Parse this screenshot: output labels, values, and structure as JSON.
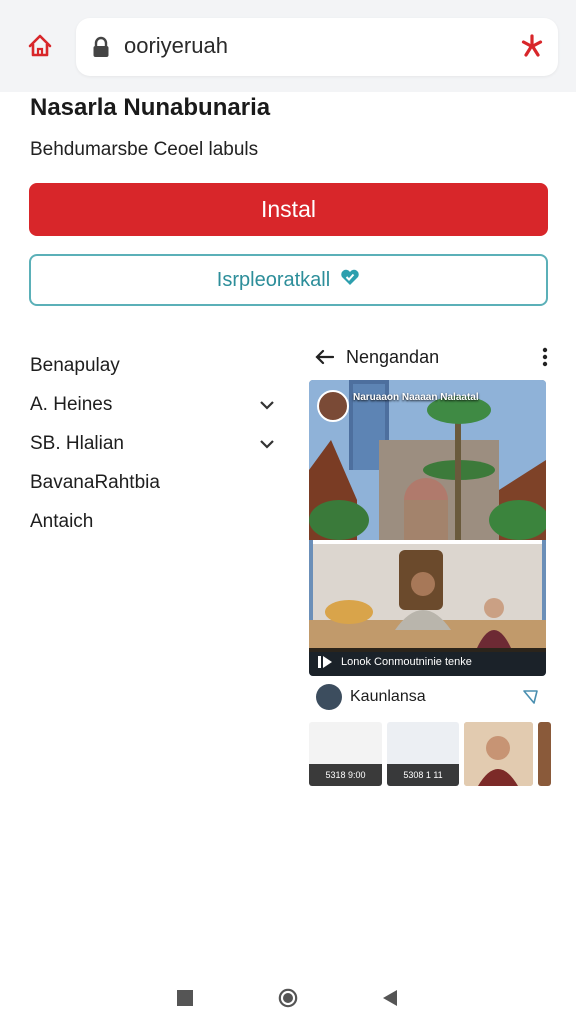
{
  "browser": {
    "url": "ooriyeruah",
    "icons": {
      "home": "home-icon",
      "lock": "lock-icon",
      "menu": "star-menu-icon"
    }
  },
  "app": {
    "title": "Nasarla Nunabunaria",
    "subtitle": "Behdumarsbe Ceoel labuls",
    "install_label": "Instal",
    "explore_label": "Isrpleoratkall"
  },
  "menu": {
    "items": [
      {
        "label": "Benapulay",
        "expandable": false
      },
      {
        "label": "A. Heines",
        "expandable": true
      },
      {
        "label": "SB. Hlalian",
        "expandable": true
      },
      {
        "label": "BavanaRahtbia",
        "expandable": false
      },
      {
        "label": "Antaich",
        "expandable": false
      }
    ]
  },
  "panel": {
    "title": "Nengandan",
    "video_caption": "Naruaaon Naaaan Nalaatal",
    "video_bar_text": "Lonok Conmoutninie tenke",
    "channel_name": "Kaunlansa",
    "thumbs": [
      {
        "label": "5318 9:00"
      },
      {
        "label": "5308 1 11"
      }
    ]
  },
  "colors": {
    "accent": "#d8262a",
    "teal": "#2d8e9a",
    "teal_border": "#5bb0b8"
  }
}
